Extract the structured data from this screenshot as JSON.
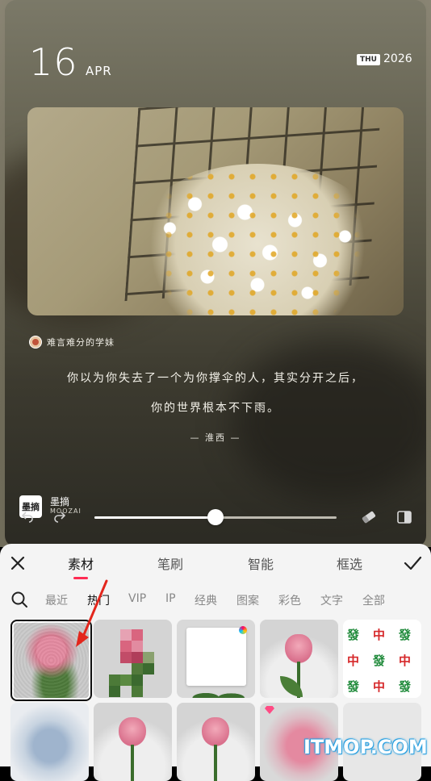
{
  "card": {
    "day": "16",
    "month": "APR",
    "weekday": "THU",
    "year": "2026",
    "author": "难言难分的学妹",
    "quote_line1": "你以为你失去了一个为你撑伞的人，其实分开之后，",
    "quote_line2": "你的世界根本不下雨。",
    "signature": "— 淮西 —",
    "brand_logo": "墨摘",
    "brand_name": "墨摘",
    "brand_sub": "MOOZAI"
  },
  "slider": {
    "value": 0.5
  },
  "sheet": {
    "tabs": [
      {
        "label": "素材",
        "active": true
      },
      {
        "label": "笔刷",
        "active": false
      },
      {
        "label": "智能",
        "active": false
      },
      {
        "label": "框选",
        "active": false
      }
    ],
    "categories": [
      {
        "label": "最近",
        "active": false
      },
      {
        "label": "热门",
        "active": true
      },
      {
        "label": "VIP",
        "active": false
      },
      {
        "label": "IP",
        "active": false
      },
      {
        "label": "经典",
        "active": false
      },
      {
        "label": "图案",
        "active": false
      },
      {
        "label": "彩色",
        "active": false
      },
      {
        "label": "文字",
        "active": false
      },
      {
        "label": "全部",
        "active": false
      }
    ],
    "mahjong_tiles": [
      "發",
      "中",
      "發",
      "中",
      "發",
      "中",
      "發",
      "中",
      "發"
    ]
  },
  "colors": {
    "accent": "#ff2b53",
    "arrow": "#e3261c",
    "mahjong_red": "#d6282a",
    "mahjong_green": "#1f8a3a"
  },
  "watermark": "ITMOP.COM"
}
